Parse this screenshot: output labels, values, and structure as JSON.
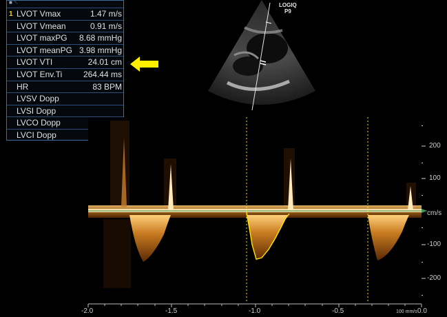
{
  "panel": {
    "header_label": "■ ␡",
    "rows": [
      {
        "index": "1",
        "name": "LVOT Vmax",
        "value": "1.47 m/s"
      },
      {
        "index": "",
        "name": "LVOT Vmean",
        "value": "0.91 m/s"
      },
      {
        "index": "",
        "name": "LVOT maxPG",
        "value": "8.68 mmHg"
      },
      {
        "index": "",
        "name": "LVOT meanPG",
        "value": "3.98 mmHg"
      },
      {
        "index": "",
        "name": "LVOT VTI",
        "value": "24.01 cm"
      },
      {
        "index": "",
        "name": "LVOT Env.Ti",
        "value": "264.44 ms"
      },
      {
        "index": "",
        "name": "HR",
        "value": "83 BPM"
      },
      {
        "index": "",
        "name": "LVSV Dopp",
        "value": ""
      },
      {
        "index": "",
        "name": "LVSI Dopp",
        "value": ""
      },
      {
        "index": "",
        "name": "LVCO Dopp",
        "value": ""
      },
      {
        "index": "",
        "name": "LVCI Dopp",
        "value": ""
      }
    ]
  },
  "logo": {
    "line1": "LOGIQ",
    "line2": "P9"
  },
  "velocity_axis": {
    "unit": "cm/s",
    "ticks": [
      "200",
      "100",
      "-100",
      "-200"
    ]
  },
  "time_axis": {
    "ticks": [
      "-2.0",
      "-1.5",
      "-1.0",
      "-0.5",
      "0.0"
    ],
    "sweep_label": "100 mm/s"
  },
  "colors": {
    "arrow": "#ffee00",
    "trace": "#ffe100",
    "panel_border": "#3b6fa3",
    "baseline": "#3f9a5a"
  }
}
